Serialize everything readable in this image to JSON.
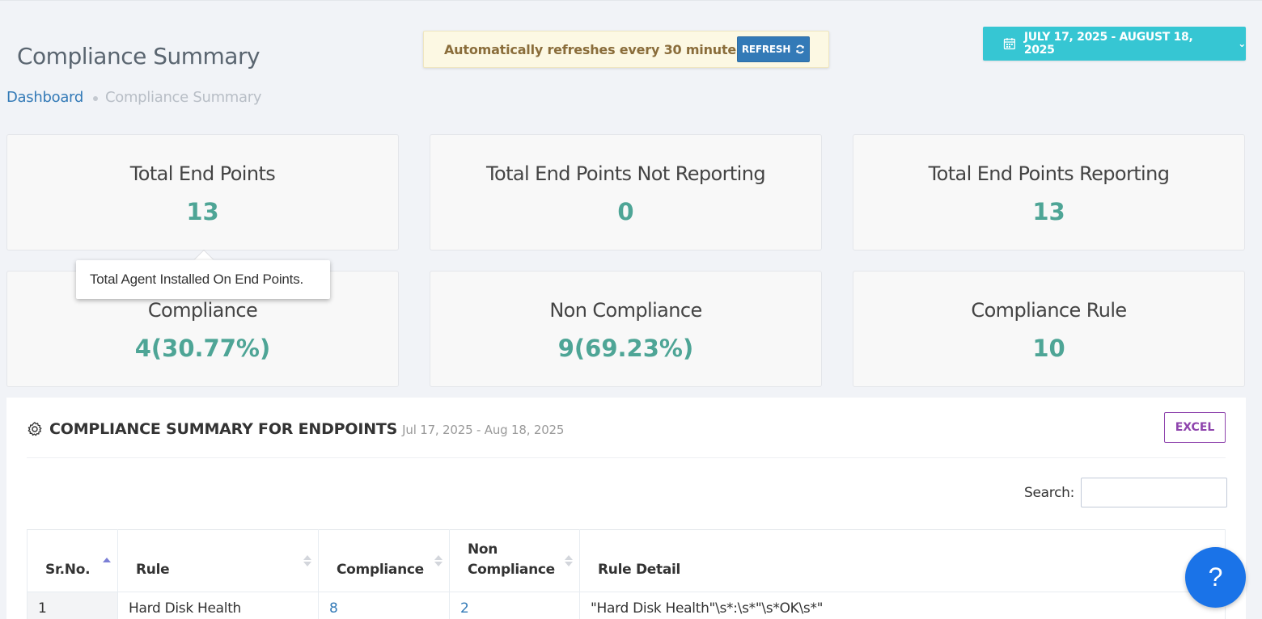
{
  "header": {
    "title": "Compliance Summary",
    "breadcrumb": {
      "home": "Dashboard",
      "current": "Compliance Summary"
    },
    "refresh_message": "Automatically refreshes every 30 minutes",
    "refresh_label": "REFRESH",
    "date_range": "JULY 17, 2025 - AUGUST 18, 2025"
  },
  "stats": [
    {
      "label": "Total End Points",
      "value": "13"
    },
    {
      "label": "Total End Points Not Reporting",
      "value": "0"
    },
    {
      "label": "Total End Points Reporting",
      "value": "13"
    },
    {
      "label": "Compliance",
      "value": "4(30.77%)"
    },
    {
      "label": "Non Compliance",
      "value": "9(69.23%)"
    },
    {
      "label": "Compliance Rule",
      "value": "10"
    }
  ],
  "tooltip": "Total Agent Installed On End Points.",
  "portlet": {
    "title": "COMPLIANCE SUMMARY FOR ENDPOINTS",
    "range": "Jul 17, 2025 - Aug 18, 2025",
    "excel_label": "EXCEL",
    "search_label": "Search:",
    "search_value": ""
  },
  "table": {
    "headers": [
      "Sr.No.",
      "Rule",
      "Compliance",
      "Non Compliance",
      "Rule Detail"
    ],
    "rows": [
      [
        "1",
        "Hard Disk Health",
        "8",
        "2",
        "\"Hard Disk Health\"\\s*:\\s*\"\\s*OK\\s*\""
      ]
    ]
  },
  "help_label": "?",
  "colors": {
    "accent": "#36c6d3",
    "value": "#4ea596",
    "primary": "#337ab7",
    "excel": "#8e44ad"
  }
}
